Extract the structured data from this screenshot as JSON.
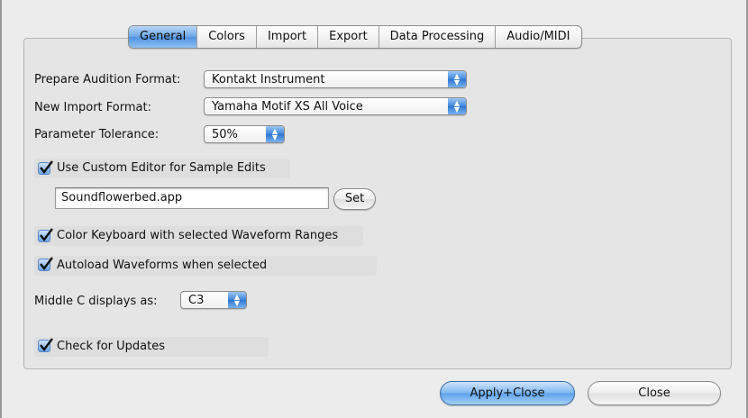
{
  "tabs": [
    {
      "label": "General",
      "active": true
    },
    {
      "label": "Colors",
      "active": false
    },
    {
      "label": "Import",
      "active": false
    },
    {
      "label": "Export",
      "active": false
    },
    {
      "label": "Data Processing",
      "active": false
    },
    {
      "label": "Audio/MIDI",
      "active": false
    }
  ],
  "settings": {
    "prepare_audition": {
      "label": "Prepare Audition Format:",
      "value": "Kontakt Instrument"
    },
    "new_import": {
      "label": "New Import Format:",
      "value": "Yamaha Motif XS All Voice"
    },
    "parameter_tolerance": {
      "label": "Parameter Tolerance:",
      "value": "50%"
    },
    "custom_editor": {
      "label": "Use Custom Editor for Sample Edits",
      "checked": true
    },
    "editor_app": {
      "value": "Soundflowerbed.app",
      "set_label": "Set"
    },
    "color_keyboard": {
      "label": "Color Keyboard with selected Waveform Ranges",
      "checked": true
    },
    "autoload_waveforms": {
      "label": "Autoload Waveforms when selected",
      "checked": true
    },
    "middle_c": {
      "label": "Middle C displays as:",
      "value": "C3"
    },
    "check_updates": {
      "label": "Check for Updates",
      "checked": true
    }
  },
  "buttons": {
    "apply_close": "Apply+Close",
    "close": "Close"
  },
  "colors": {
    "accent": "#4e92e0",
    "window_bg": "#ececec"
  }
}
